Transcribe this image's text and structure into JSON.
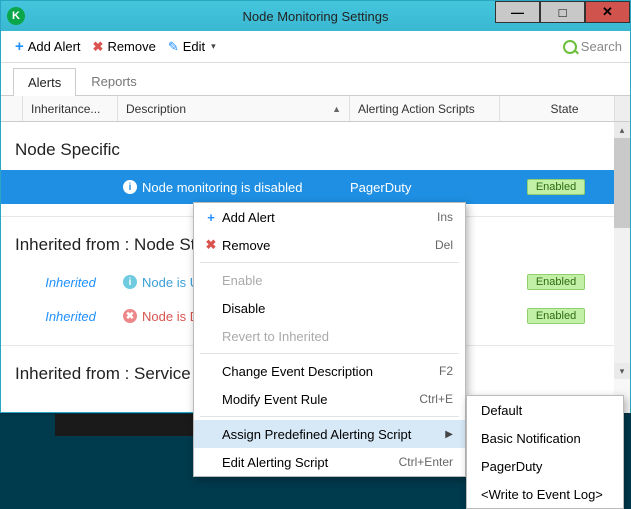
{
  "window": {
    "title": "Node Monitoring Settings"
  },
  "toolbar": {
    "add_alert": "Add Alert",
    "remove": "Remove",
    "edit": "Edit",
    "search_placeholder": "Search"
  },
  "tabs": {
    "alerts": "Alerts",
    "reports": "Reports"
  },
  "columns": {
    "inheritance": "Inheritance...",
    "description": "Description",
    "alerting_scripts": "Alerting Action Scripts",
    "state": "State"
  },
  "sections": {
    "node_specific": "Node Specific",
    "inherited_node": "Inherited from : Node St",
    "inherited_service": "Inherited from : Service"
  },
  "rows": {
    "r0": {
      "desc": "Node monitoring is disabled",
      "action": "PagerDuty",
      "state": "Enabled"
    },
    "r1": {
      "inh": "Inherited",
      "desc": "Node is UP",
      "state": "Enabled"
    },
    "r2": {
      "inh": "Inherited",
      "desc": "Node is DO",
      "state": "Enabled"
    }
  },
  "context_menu": {
    "add_alert": {
      "label": "Add Alert",
      "accel": "Ins"
    },
    "remove": {
      "label": "Remove",
      "accel": "Del"
    },
    "enable": {
      "label": "Enable"
    },
    "disable": {
      "label": "Disable"
    },
    "revert": {
      "label": "Revert to Inherited"
    },
    "change_desc": {
      "label": "Change Event Description",
      "accel": "F2"
    },
    "modify_rule": {
      "label": "Modify Event Rule",
      "accel": "Ctrl+E"
    },
    "assign_script": {
      "label": "Assign Predefined Alerting Script"
    },
    "edit_script": {
      "label": "Edit Alerting Script",
      "accel": "Ctrl+Enter"
    }
  },
  "submenu": {
    "default": "Default",
    "basic": "Basic Notification",
    "pagerduty": "PagerDuty",
    "eventlog": "<Write to Event Log>"
  }
}
